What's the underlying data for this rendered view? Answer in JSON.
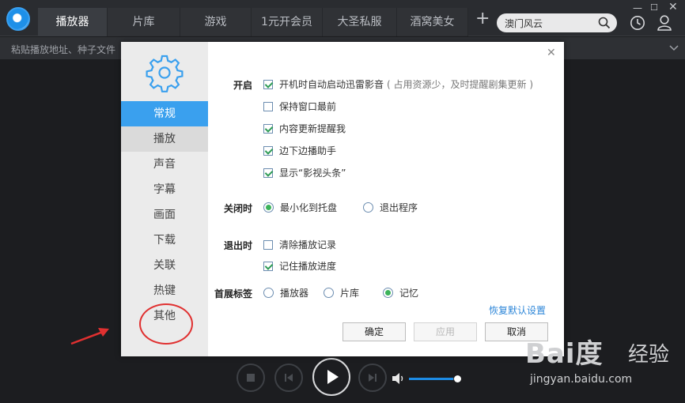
{
  "topbar": {
    "tabs": [
      {
        "label": "播放器",
        "active": true,
        "w": 88
      },
      {
        "label": "片库",
        "active": false,
        "w": 92
      },
      {
        "label": "游戏",
        "active": false,
        "w": 90
      },
      {
        "label": "1元开会员",
        "active": false,
        "w": 90
      },
      {
        "label": "大圣私服",
        "active": false,
        "w": 94
      },
      {
        "label": "酒窝美女",
        "active": false,
        "w": 90
      }
    ],
    "plus": "+",
    "search_value": "澳门风云"
  },
  "address_bar": {
    "text": "粘贴播放地址、种子文件"
  },
  "dialog": {
    "nav": [
      {
        "label": "常规",
        "state": "active"
      },
      {
        "label": "播放",
        "state": "hover"
      },
      {
        "label": "声音",
        "state": ""
      },
      {
        "label": "字幕",
        "state": ""
      },
      {
        "label": "画面",
        "state": ""
      },
      {
        "label": "下载",
        "state": ""
      },
      {
        "label": "关联",
        "state": ""
      },
      {
        "label": "热键",
        "state": ""
      },
      {
        "label": "其他",
        "state": ""
      }
    ],
    "sections": {
      "startup": "开启",
      "on_close": "关闭时",
      "on_exit": "退出时",
      "first_tab": "首展标签"
    },
    "startup_options": [
      {
        "label": "开机时自动启动迅雷影音",
        "note": "( 占用资源少，及时提醒剧集更新 )",
        "checked": true
      },
      {
        "label": "保持窗口最前",
        "checked": false
      },
      {
        "label": "内容更新提醒我",
        "checked": true
      },
      {
        "label": "边下边播助手",
        "checked": true
      },
      {
        "label": "显示“影视头条”",
        "checked": true
      }
    ],
    "close_options": [
      {
        "label": "最小化到托盘",
        "selected": true
      },
      {
        "label": "退出程序",
        "selected": false
      }
    ],
    "exit_options": [
      {
        "label": "清除播放记录",
        "checked": false
      },
      {
        "label": "记住播放进度",
        "checked": true
      }
    ],
    "tab_options": [
      {
        "label": "播放器",
        "selected": false
      },
      {
        "label": "片库",
        "selected": false
      },
      {
        "label": "记忆",
        "selected": true
      }
    ],
    "restore_link": "恢复默认设置",
    "buttons": {
      "ok": "确定",
      "apply": "应用",
      "cancel": "取消"
    }
  },
  "player": {
    "volume_level": 0.9
  },
  "watermark": {
    "logo": "Bai度",
    "jingyan": "经验",
    "url": "jingyan.baidu.com"
  },
  "colors": {
    "accent": "#3aa0ee",
    "check": "#3cb35a",
    "annotation": "#e03030"
  }
}
